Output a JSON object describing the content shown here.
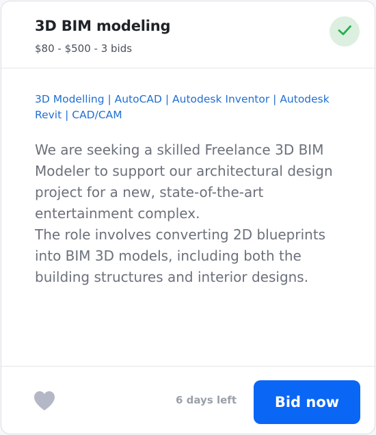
{
  "job": {
    "title": "3D BIM modeling",
    "budget_bids": "$80 - $500 - 3 bids",
    "skills": "3D Modelling | AutoCAD | Autodesk Inventor | Autodesk Revit | CAD/CAM",
    "description": "We are seeking a skilled Freelance 3D BIM Modeler to support our architectural design project for a new, state-of-the-art entertainment complex.\nThe role involves converting 2D blueprints into BIM 3D models, including both the building structures and interior designs.",
    "days_left": "6 days left",
    "bid_label": "Bid now"
  },
  "icons": {
    "status": "check-icon",
    "favorite": "heart-icon"
  },
  "colors": {
    "accent": "#0a66f5",
    "skills": "#1f6fd1",
    "check": "#22b14c",
    "check_bg": "#dcefe0",
    "heart": "#b3b7c6"
  }
}
